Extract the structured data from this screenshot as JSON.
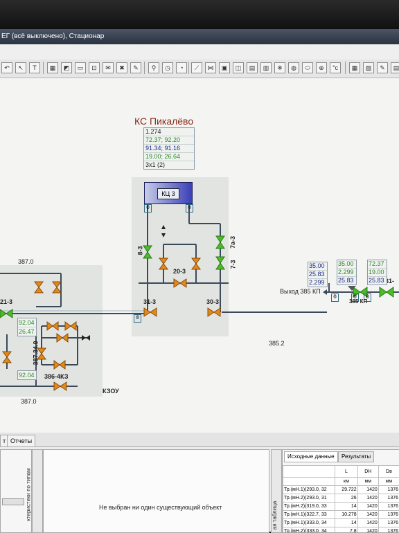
{
  "window": {
    "title": "ЕГ (всё выключено), Стационар"
  },
  "station": {
    "name": "КС Пикалёво",
    "params": [
      "1.274",
      "72.37; 92.20",
      "91.34; 91.16",
      "19.00; 26.64",
      "3х1 (2)"
    ],
    "shop": "КЦ 3"
  },
  "valves": {
    "v8_3": "8-3",
    "v7a_3": "7а-3",
    "v7_3": "7-3",
    "v20_3": "20-3",
    "v31_3": "31-3",
    "v30_3": "30-3",
    "v21_3": "21-3",
    "v386": "386-4КЗ",
    "v385": "385 КП",
    "v31_right": "31-"
  },
  "levels": {
    "l387_top": "387.0",
    "l387_bottom": "387.0",
    "l385": "385.2",
    "l387_34": "387.34.0"
  },
  "left_box": {
    "a": "92.04",
    "b": "26.47",
    "c": "92.04"
  },
  "exit": {
    "label": "Выход 385 КП"
  },
  "right_boxes": {
    "b1": [
      "35.00",
      "25.83",
      "2.299"
    ],
    "b2": [
      "35.00",
      "2.299",
      "25.83"
    ],
    "b3": [
      "72.37",
      "19.00",
      "25.83"
    ]
  },
  "markers": {
    "zero": "0"
  },
  "area_label": "КЗОУ",
  "bottom_tabs": {
    "tab1": "т",
    "tab2": "Отчеты"
  },
  "message": "Не выбран ни один существующий объект",
  "side_label": "ктеристики по типам",
  "right_panel": {
    "tabs": [
      "Исходные данные",
      "Результаты"
    ],
    "side_label": "ая таблица",
    "headers": [
      "",
      "L",
      "DН",
      "Dв"
    ],
    "units": [
      "",
      "км",
      "мм",
      "мм"
    ],
    "rows": [
      [
        "Тр.(мН.1)(293.0, 32",
        "29.722",
        "1420",
        "1376"
      ],
      [
        "Тр.(мН.2)(293.0, 31",
        "26",
        "1420",
        "1376"
      ],
      [
        "Тр.(мН.2)(319.0, 33",
        "14",
        "1420",
        "1376"
      ],
      [
        "Тр.(мН.1)(322.7, 33",
        "10.278",
        "1420",
        "1376"
      ],
      [
        "Тр.(мН.1)(333.0, 34",
        "14",
        "1420",
        "1376"
      ],
      [
        "Тр.(мН.2)(333.0, 34",
        "7.8",
        "1420",
        "1376"
      ]
    ]
  },
  "colors": {
    "pipe": "#3b4a5a",
    "valve": "#4cba2a",
    "valve_dark": "#2c7a14",
    "station_name": "#8b2a1a",
    "shop_box": "#3a3fb8"
  }
}
